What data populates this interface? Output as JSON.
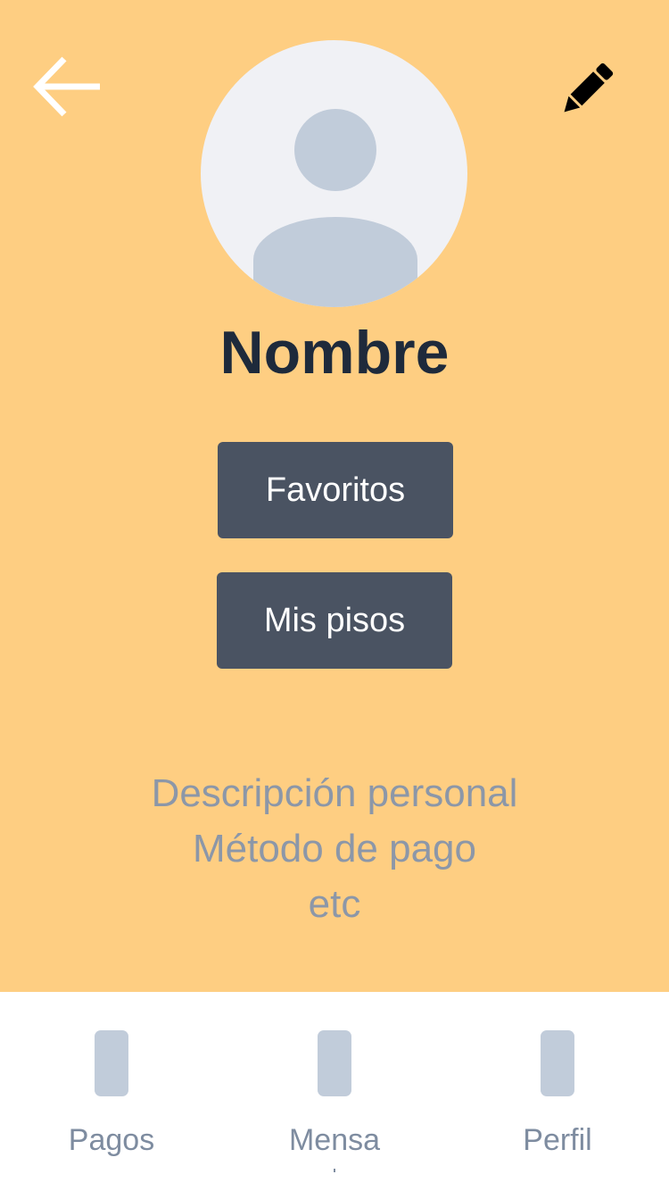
{
  "profile": {
    "name": "Nombre"
  },
  "buttons": {
    "favorites_label": "Favoritos",
    "my_flats_label": "Mis pisos"
  },
  "info": {
    "line1": "Descripción personal",
    "line2": "Método de pago",
    "line3": "etc"
  },
  "icons": {
    "back": "arrow-left",
    "edit": "pencil",
    "avatar": "user-placeholder"
  },
  "tabs": [
    {
      "label": "Pagos"
    },
    {
      "label": "Mensa"
    },
    {
      "label": "Perfil"
    }
  ],
  "colors": {
    "background": "#FECE82",
    "button": "#4A5362",
    "name_text": "#1E2A3B",
    "info_text": "#8C97A8",
    "tab_icon": "#C1CCDA",
    "tab_label": "#7E8CA0"
  }
}
